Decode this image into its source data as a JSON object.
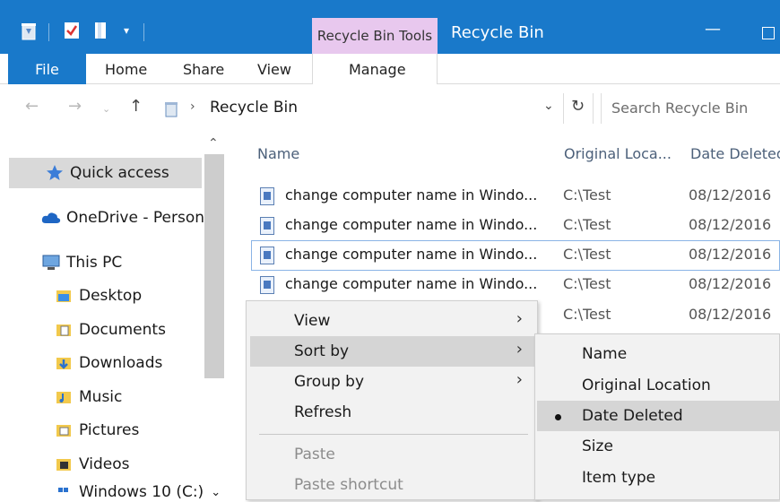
{
  "window": {
    "title": "Recycle Bin",
    "contextual_tab_group": "Recycle Bin Tools",
    "accent_color": "#1979ca",
    "contextual_color": "#e8c8ee"
  },
  "ribbon": {
    "tabs": [
      "File",
      "Home",
      "Share",
      "View",
      "Manage"
    ]
  },
  "address": {
    "path": "Recycle Bin",
    "search_placeholder": "Search Recycle Bin"
  },
  "nav": {
    "items": [
      {
        "label": "Quick access",
        "icon": "star-icon"
      },
      {
        "label": "OneDrive - Person",
        "icon": "cloud-icon"
      },
      {
        "label": "This PC",
        "icon": "computer-icon"
      },
      {
        "label": "Desktop",
        "icon": "folder-icon"
      },
      {
        "label": "Documents",
        "icon": "documents-icon"
      },
      {
        "label": "Downloads",
        "icon": "downloads-icon"
      },
      {
        "label": "Music",
        "icon": "music-icon"
      },
      {
        "label": "Pictures",
        "icon": "pictures-icon"
      },
      {
        "label": "Videos",
        "icon": "videos-icon"
      },
      {
        "label": "Windows 10 (C:)",
        "icon": "drive-icon"
      }
    ]
  },
  "columns": {
    "name": "Name",
    "original_location": "Original Loca...",
    "date_deleted": "Date Deleted"
  },
  "files": [
    {
      "name": "change computer name in Windo...",
      "location": "C:\\Test",
      "date": "08/12/2016"
    },
    {
      "name": "change computer name in Windo...",
      "location": "C:\\Test",
      "date": "08/12/2016"
    },
    {
      "name": "change computer name in Windo...",
      "location": "C:\\Test",
      "date": "08/12/2016"
    },
    {
      "name": "change computer name in Windo...",
      "location": "C:\\Test",
      "date": "08/12/2016"
    },
    {
      "name": "",
      "location": "C:\\Test",
      "date": "08/12/2016"
    }
  ],
  "context_menu": {
    "items": [
      {
        "label": "View",
        "submenu": true
      },
      {
        "label": "Sort by",
        "submenu": true,
        "highlighted": true
      },
      {
        "label": "Group by",
        "submenu": true
      },
      {
        "label": "Refresh"
      },
      {
        "label": "Paste",
        "disabled": true
      },
      {
        "label": "Paste shortcut",
        "disabled": true
      }
    ]
  },
  "sort_submenu": {
    "items": [
      {
        "label": "Name"
      },
      {
        "label": "Original Location"
      },
      {
        "label": "Date Deleted",
        "selected": true
      },
      {
        "label": "Size"
      },
      {
        "label": "Item type"
      }
    ]
  }
}
